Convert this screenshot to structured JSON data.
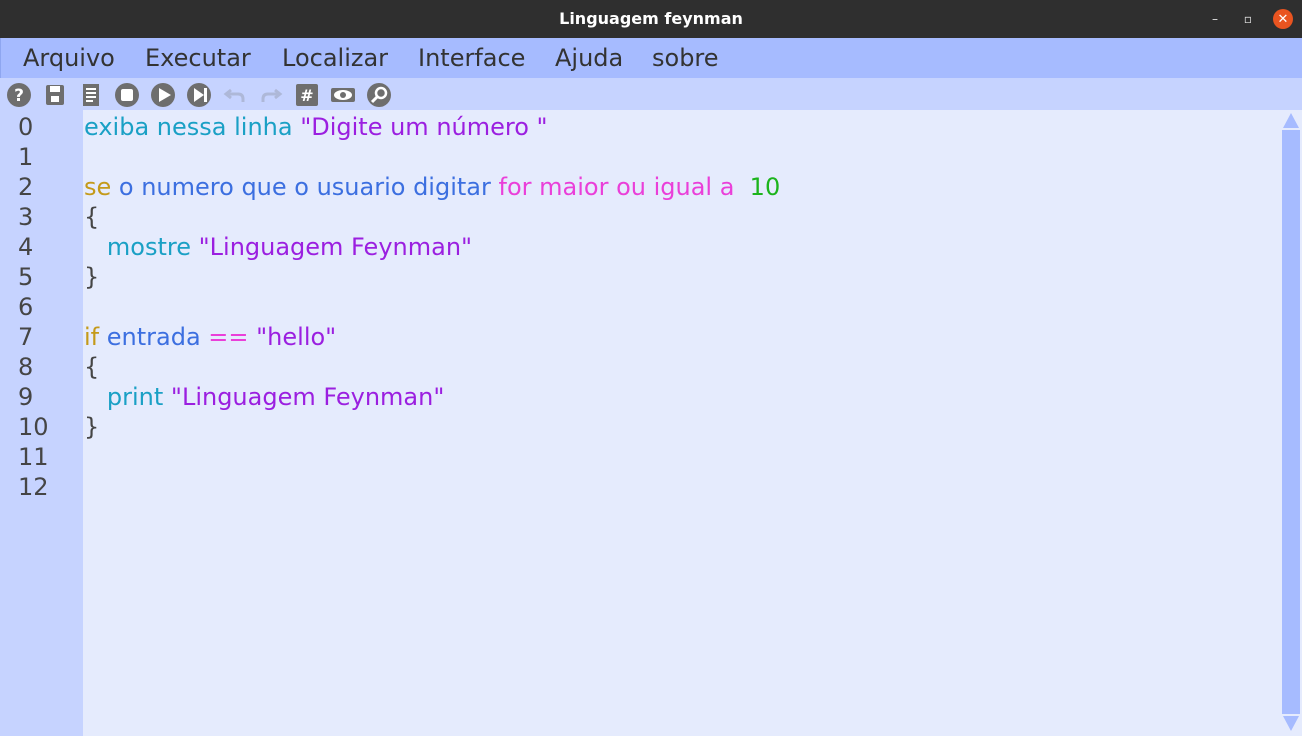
{
  "window": {
    "title": "Linguagem feynman"
  },
  "window_controls": {
    "minimize": "–",
    "maximize": "▫",
    "close": "✕"
  },
  "menu": [
    "Arquivo",
    "Executar",
    "Localizar",
    "Interface",
    "Ajuda",
    "sobre"
  ],
  "toolbar": [
    {
      "name": "help-icon"
    },
    {
      "name": "save-icon"
    },
    {
      "name": "document-icon"
    },
    {
      "name": "stop-icon"
    },
    {
      "name": "run-icon"
    },
    {
      "name": "run-step-icon"
    },
    {
      "name": "undo-icon"
    },
    {
      "name": "redo-icon"
    },
    {
      "name": "hash-icon"
    },
    {
      "name": "eye-icon"
    },
    {
      "name": "search-icon"
    }
  ],
  "colors": {
    "title_bg": "#2f2f2f",
    "menubar_bg": "#a6bbff",
    "toolbar_bg": "#c6d3ff",
    "editor_bg": "#e5ebfd",
    "gutter_bg": "#c6d3ff",
    "kw_cyan": "#1aa0c5",
    "kw_blue": "#3c6fe0",
    "kw_olive": "#c49a1a",
    "kw_magenta": "#ea3fd9",
    "string_purple": "#9b1fe0",
    "number_green": "#1cb41c",
    "text_dark": "#454545"
  },
  "editor": {
    "line_numbers": [
      "0",
      "1",
      "2",
      "3",
      "4",
      "5",
      "6",
      "7",
      "8",
      "9",
      "10",
      "11",
      "12"
    ],
    "lines": [
      [
        {
          "t": "exiba nessa linha ",
          "c": "kw_cyan"
        },
        {
          "t": "\"Digite um número \"",
          "c": "string_purple"
        }
      ],
      [],
      [
        {
          "t": "se ",
          "c": "kw_olive"
        },
        {
          "t": "o numero que o usuario digitar ",
          "c": "kw_blue"
        },
        {
          "t": "for maior ou igual a ",
          "c": "kw_magenta"
        },
        {
          "t": " 10",
          "c": "number_green"
        }
      ],
      [
        {
          "t": "{",
          "c": "text_dark"
        }
      ],
      [
        {
          "t": "   mostre ",
          "c": "kw_cyan"
        },
        {
          "t": "\"Linguagem Feynman\"",
          "c": "string_purple"
        }
      ],
      [
        {
          "t": "}",
          "c": "text_dark"
        }
      ],
      [],
      [
        {
          "t": "if ",
          "c": "kw_olive"
        },
        {
          "t": "entrada ",
          "c": "kw_blue"
        },
        {
          "t": "== ",
          "c": "kw_magenta"
        },
        {
          "t": "\"hello\"",
          "c": "string_purple"
        }
      ],
      [
        {
          "t": "{",
          "c": "text_dark"
        }
      ],
      [
        {
          "t": "   print ",
          "c": "kw_cyan"
        },
        {
          "t": "\"Linguagem Feynman\"",
          "c": "string_purple"
        }
      ],
      [
        {
          "t": "}",
          "c": "text_dark"
        }
      ],
      [],
      []
    ]
  }
}
